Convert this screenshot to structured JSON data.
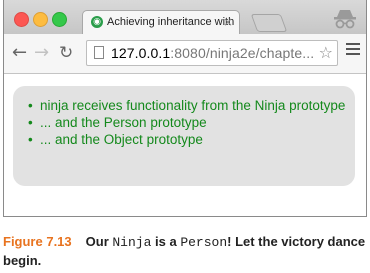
{
  "browser": {
    "tab_title": "Achieving inheritance with",
    "tab_close": "×",
    "url_host": "127.0.0.1",
    "url_path": ":8080/ninja2e/chapte...",
    "colors": {
      "close": "#fc5753",
      "minimize": "#fdbc40",
      "maximize": "#34c84a"
    }
  },
  "page": {
    "items": [
      "ninja receives functionality from the Ninja prototype",
      "... and the Person prototype",
      "... and the Object prototype"
    ],
    "text_color": "#14891c"
  },
  "caption": {
    "figure_label": "Figure 7.13",
    "part1": "Our ",
    "code1": "Ninja",
    "part2": " is a ",
    "code2": "Person",
    "part3": "! Let the victory dance begin."
  }
}
